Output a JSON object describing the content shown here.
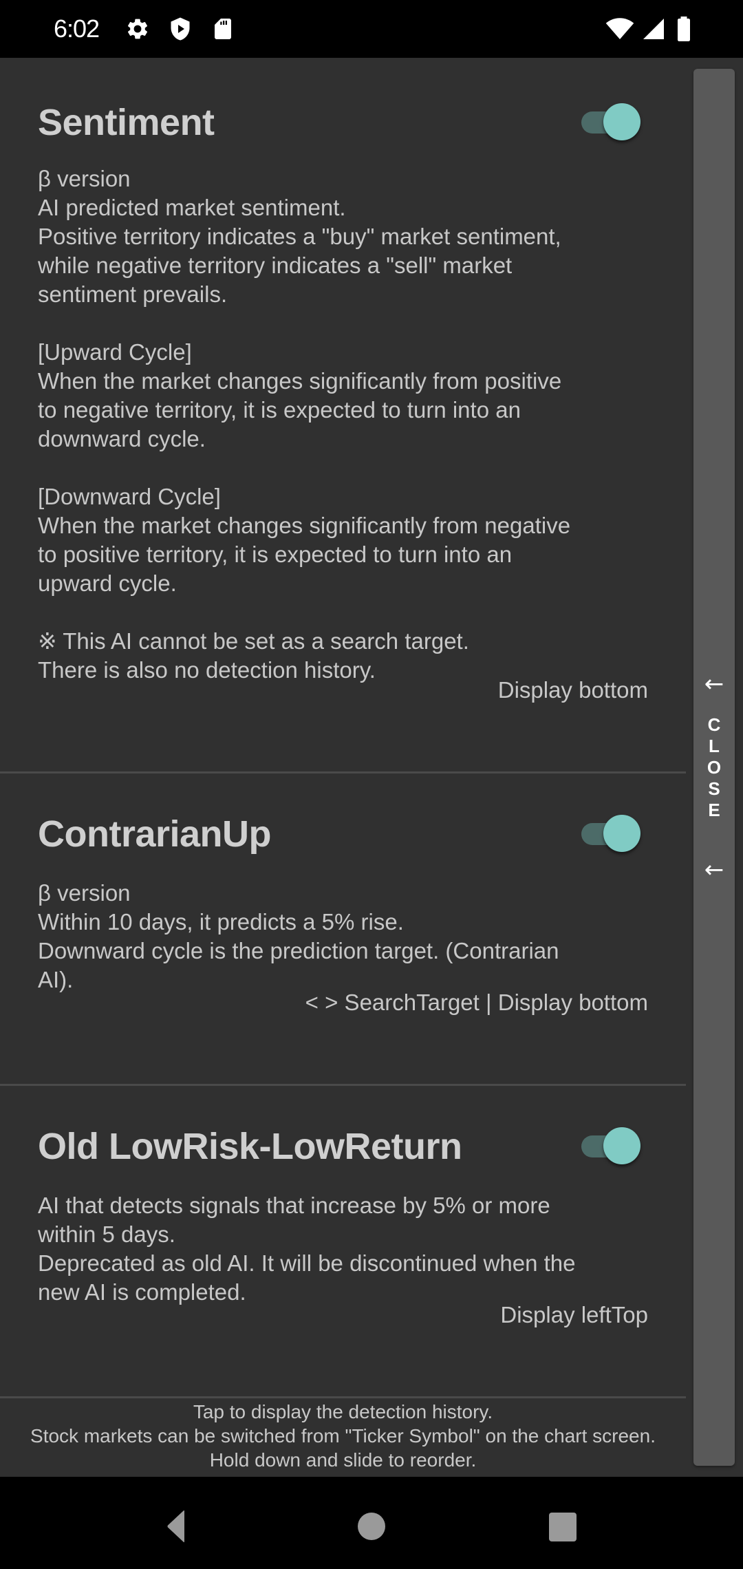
{
  "status_bar": {
    "time": "6:02",
    "left_icons": [
      "gear-icon",
      "shield-play-icon",
      "sd-card-icon"
    ],
    "right_icons": [
      "wifi-icon",
      "cell-signal-icon",
      "battery-icon"
    ]
  },
  "cards": [
    {
      "title": "Sentiment",
      "enabled": true,
      "description": "β version\nAI predicted market sentiment.\nPositive territory indicates a \"buy\" market sentiment,\nwhile negative territory indicates a \"sell\" market\nsentiment prevails.\n\n[Upward Cycle]\nWhen the market changes significantly from positive\nto negative territory, it is expected to turn into an\ndownward cycle.\n\n[Downward Cycle]\nWhen the market changes significantly from negative\nto positive territory, it is expected to turn into an\nupward cycle.\n\n※ This AI cannot be set as a search target.\nThere is also no detection history.",
      "footer": "Display bottom"
    },
    {
      "title": "ContrarianUp",
      "enabled": true,
      "description": "β version\nWithin 10 days, it predicts a 5% rise.\nDownward cycle is the prediction target. (Contrarian\nAI).",
      "footer": "< > SearchTarget | Display bottom"
    },
    {
      "title": "Old LowRisk-LowReturn",
      "enabled": true,
      "description": "AI that detects signals that increase by 5% or more\nwithin 5 days.\nDeprecated as old AI. It will be discontinued when the\nnew AI is completed.",
      "footer": "Display leftTop"
    }
  ],
  "close_panel": {
    "arrow_top": "←",
    "letters": [
      "C",
      "L",
      "O",
      "S",
      "E"
    ],
    "arrow_bottom": "←"
  },
  "hint": {
    "line1": "Tap to display the detection history.",
    "line2": "Stock markets can be switched from \"Ticker Symbol\" on the chart screen.",
    "line3": "Hold down and slide to reorder."
  },
  "nav_bar": {
    "buttons": [
      "back",
      "home",
      "recents"
    ]
  },
  "colors": {
    "background": "#303030",
    "toggle_thumb": "#80cbc4",
    "toggle_track": "#4c6b68",
    "close_panel": "#595959",
    "text": "#c8c8c8",
    "title": "#cfcfcf"
  }
}
